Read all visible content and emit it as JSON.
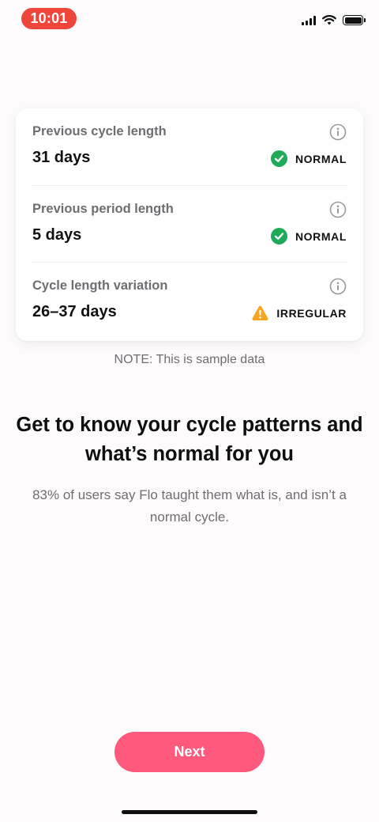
{
  "status_bar": {
    "time": "10:01",
    "icons": [
      "cellular-signal-icon",
      "wifi-icon",
      "battery-icon"
    ],
    "time_pill_color": "#f0453a"
  },
  "metrics": [
    {
      "label": "Previous cycle length",
      "value": "31 days",
      "status": "NORMAL",
      "status_icon": "check-circle-icon",
      "status_color": "#1faa5a"
    },
    {
      "label": "Previous period length",
      "value": "5 days",
      "status": "NORMAL",
      "status_icon": "check-circle-icon",
      "status_color": "#1faa5a"
    },
    {
      "label": "Cycle length variation",
      "value": "26–37 days",
      "status": "IRREGULAR",
      "status_icon": "warning-triangle-icon",
      "status_color": "#f5a623"
    }
  ],
  "note": "NOTE: This is sample data",
  "headline": "Get to know your cycle patterns and what’s normal for you",
  "subtext": "83% of users say Flo taught them what is, and isn’t a normal cycle.",
  "next_button": {
    "label": "Next",
    "color": "#ff5a7e"
  }
}
